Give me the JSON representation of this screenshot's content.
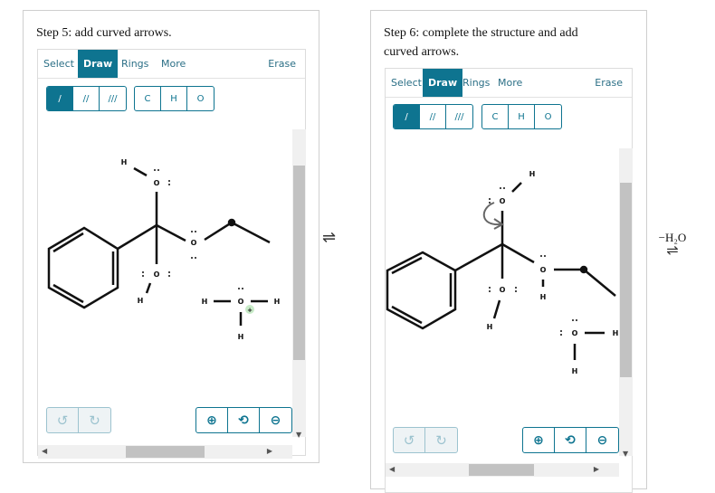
{
  "step5": {
    "title": "Step 5: add curved arrows.",
    "tabs": [
      "Select",
      "Draw",
      "Rings",
      "More"
    ],
    "erase": "Erase",
    "bond_buttons": [
      "/",
      "//",
      "///"
    ],
    "atom_buttons": [
      "C",
      "H",
      "O"
    ],
    "atom_labels": {
      "o_top": "O",
      "h_top": "H",
      "o_bottom": "O",
      "h_bottom": "H",
      "o_ether": "O",
      "h3o_o": "O",
      "h3o_h_left": "H",
      "h3o_h_right": "H",
      "h3o_h_bottom": "H",
      "charge": "+"
    }
  },
  "equilibrium_symbol": "⇌",
  "step6": {
    "title": "Step 6: complete the structure and add curved arrows.",
    "tabs": [
      "Select",
      "Draw",
      "Rings",
      "More"
    ],
    "erase": "Erase",
    "bond_buttons": [
      "/",
      "//",
      "///"
    ],
    "atom_buttons": [
      "C",
      "H",
      "O"
    ],
    "atom_labels": {
      "o_top": "O",
      "h_top": "H",
      "o_bottom": "O",
      "h_bottom": "H",
      "o_ether": "O",
      "h_ether": "H",
      "water_o": "O",
      "water_h_right": "H",
      "water_h_bottom": "H"
    }
  },
  "next_arrow_label": "−H₂O",
  "colors": {
    "accent": "#0e7490",
    "arrow": "#666666",
    "charge_bg": "#c8ebc8"
  }
}
